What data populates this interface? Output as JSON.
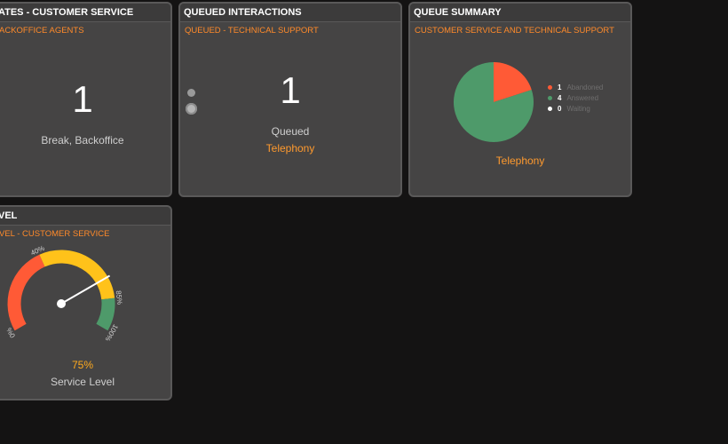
{
  "panel1": {
    "title": "ATES - CUSTOMER SERVICE",
    "subtitle": "ACKOFFICE AGENTS",
    "value": "1",
    "caption": "Break, Backoffice"
  },
  "panel2": {
    "title": "QUEUED INTERACTIONS",
    "subtitle": "QUEUED - TECHNICAL SUPPORT",
    "value": "1",
    "caption": "Queued",
    "channel": "Telephony"
  },
  "panel3": {
    "title": "QUEUE SUMMARY",
    "subtitle": "CUSTOMER SERVICE AND TECHNICAL SUPPORT",
    "channel": "Telephony",
    "legend": [
      {
        "count": "1",
        "label": "Abandoned",
        "color": "#ff5a36"
      },
      {
        "count": "4",
        "label": "Answered",
        "color": "#4e9a6a"
      },
      {
        "count": "0",
        "label": "Waiting",
        "color": "#ffffff"
      }
    ]
  },
  "panel4": {
    "title": "VEL",
    "subtitle": "VEL - CUSTOMER SERVICE",
    "value": "75%",
    "caption": "Service Level",
    "gauge_value": 75,
    "ticks": [
      "0%",
      "40%",
      "85%",
      "100%"
    ]
  },
  "chart_data": [
    {
      "type": "pie",
      "categories": [
        "Abandoned",
        "Answered",
        "Waiting"
      ],
      "values": [
        1,
        4,
        0
      ],
      "colors": [
        "#ff5a36",
        "#4e9a6a",
        "#ffffff"
      ]
    }
  ],
  "colors": {
    "background": "#141313",
    "panel": "#454444",
    "accent": "#ff8a2a",
    "red": "#ff5a36",
    "yellow": "#ffc21a",
    "green": "#4e9a6a"
  }
}
